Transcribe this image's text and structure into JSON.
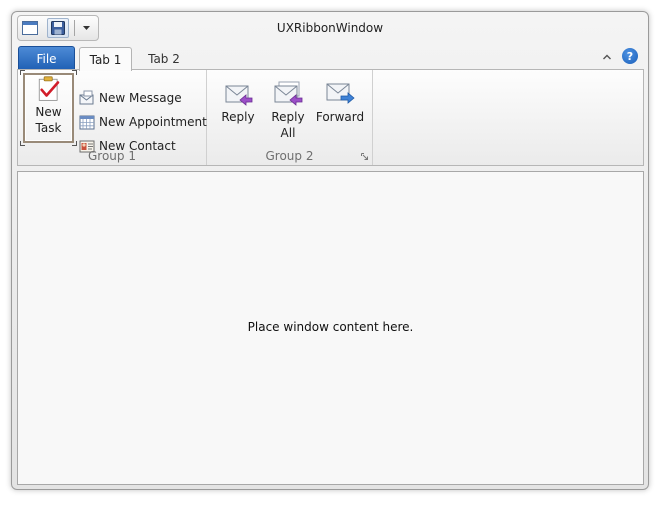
{
  "window": {
    "title": "UXRibbonWindow"
  },
  "quick_access": {
    "system_menu": "system-menu-icon",
    "save": "save-icon",
    "customize": "dropdown-arrow-icon"
  },
  "tabs": {
    "file_label": "File",
    "items": [
      {
        "label": "Tab 1",
        "selected": true
      },
      {
        "label": "Tab 2",
        "selected": false
      }
    ]
  },
  "ribbon": {
    "group1": {
      "label": "Group 1",
      "new_task": {
        "line1": "New",
        "line2": "Task"
      },
      "small_buttons": [
        {
          "label": "New Message",
          "icon": "new-message-icon"
        },
        {
          "label": "New Appointment",
          "icon": "calendar-icon"
        },
        {
          "label": "New Contact",
          "icon": "contact-card-icon"
        }
      ]
    },
    "group2": {
      "label": "Group 2",
      "buttons": [
        {
          "line1": "Reply",
          "line2": "",
          "icon": "reply-icon"
        },
        {
          "line1": "Reply",
          "line2": "All",
          "icon": "reply-all-icon"
        },
        {
          "line1": "Forward",
          "line2": "",
          "icon": "forward-icon"
        }
      ]
    }
  },
  "content": {
    "placeholder": "Place window content here."
  },
  "colors": {
    "file_tab": "#2b6cc4",
    "help": "#1a5fb9"
  }
}
